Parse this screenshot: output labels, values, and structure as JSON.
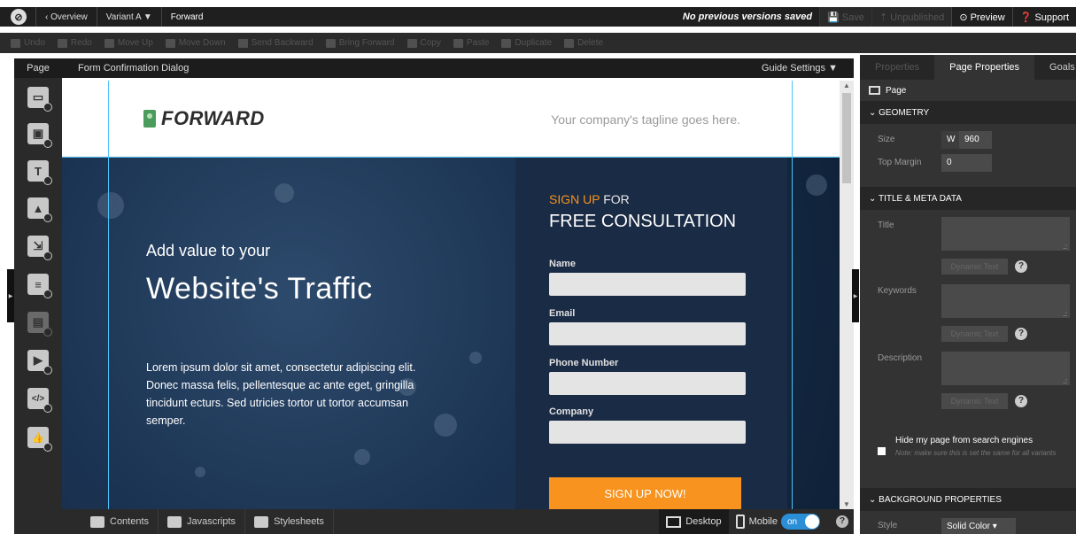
{
  "topbar": {
    "logo_glyph": "⊘",
    "overview": "‹  Overview",
    "variant": "Variant A ▼",
    "page_name": "Forward",
    "status": "No previous versions saved",
    "save": "💾 Save",
    "unpublished": "⇡ Unpublished",
    "preview": "⊙ Preview",
    "support": "❓ Support"
  },
  "toolbar": {
    "items": [
      "Undo",
      "Redo",
      "Move Up",
      "Move Down",
      "Send Backward",
      "Bring Forward",
      "Copy",
      "Paste",
      "Duplicate",
      "Delete"
    ]
  },
  "leftbar": {
    "tab": "Page",
    "icons": [
      "section-icon",
      "box-icon",
      "text-icon",
      "image-icon",
      "button-icon",
      "form-icon",
      "lightbox-icon",
      "video-icon",
      "code-icon",
      "social-icon"
    ],
    "glyphs": [
      "▭",
      "▣",
      "T",
      "▲",
      "⇲",
      "≡",
      "▤",
      "▶",
      "</>",
      "👍"
    ]
  },
  "canvas": {
    "title": "Form Confirmation Dialog",
    "guide_settings": "Guide Settings  ▼"
  },
  "landing": {
    "logo_text": "FORWARD",
    "tagline": "Your company's tagline goes here.",
    "add_value": "Add value to your",
    "headline": "Website's Traffic",
    "body": "Lorem ipsum dolor sit amet, consectetur adipiscing elit. Donec massa felis, pellentesque ac ante eget, gringilla tincidunt ecturs. Sed utricies tortor ut tortor accumsan semper.",
    "form": {
      "sign_up": "SIGN UP",
      "for": " FOR",
      "free_consultation": "FREE CONSULTATION",
      "fields": [
        "Name",
        "Email",
        "Phone Number",
        "Company"
      ],
      "button": "SIGN UP NOW!"
    }
  },
  "bottombar": {
    "contents": "Contents",
    "javascripts": "Javascripts",
    "stylesheets": "Stylesheets",
    "desktop": "Desktop",
    "mobile": "Mobile",
    "toggle": "on",
    "help": "?"
  },
  "rightpanel": {
    "tabs": [
      "Properties",
      "Page Properties",
      "Goals"
    ],
    "page_label": "Page",
    "geometry": {
      "header": "⌄ GEOMETRY",
      "size_label": "Size",
      "w_label": "W",
      "width": "960",
      "top_margin_label": "Top Margin",
      "top_margin": "0"
    },
    "meta": {
      "header": "⌄ TITLE & META DATA",
      "title_label": "Title",
      "keywords_label": "Keywords",
      "description_label": "Description",
      "dynamic_text": "Dynamic Text",
      "help": "?"
    },
    "hide": {
      "label": "Hide my page from search engines",
      "note": "Note: make sure this is set the same for all variants"
    },
    "background": {
      "header": "⌄ BACKGROUND PROPERTIES",
      "style_label": "Style",
      "style_value": "Solid Color  ▾"
    }
  },
  "colors": {
    "accent": "#f7931e",
    "toggle": "#2a8fd6",
    "guides": "#4fc3f7"
  }
}
